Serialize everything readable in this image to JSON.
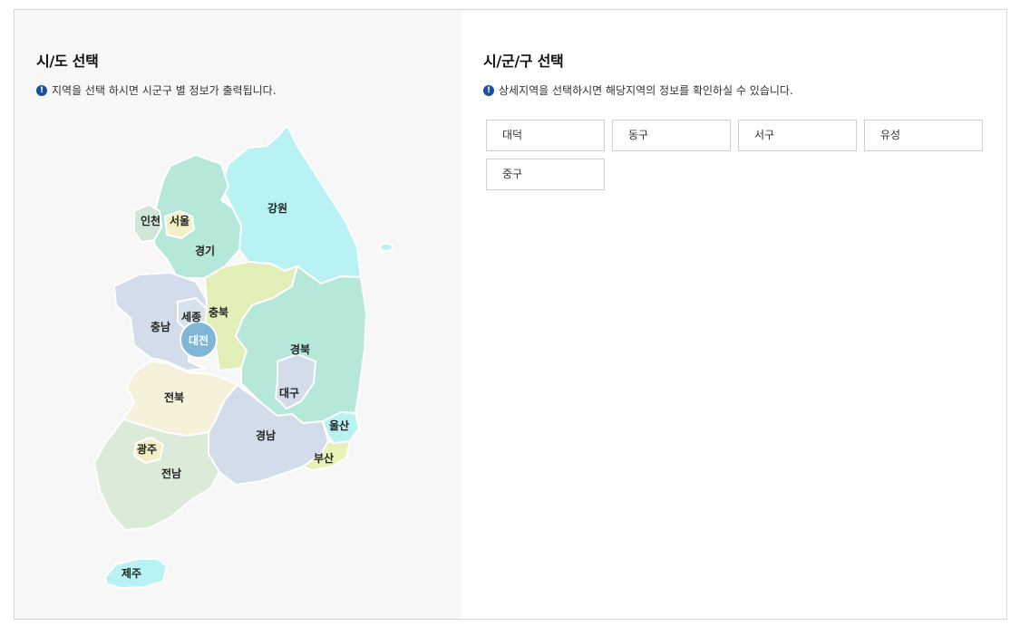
{
  "left": {
    "title": "시/도 선택",
    "info": "지역을 선택 하시면 시군구 별 정보가 출력됩니다.",
    "info_icon": "exclamation-icon",
    "selected_region": "대전",
    "regions": [
      {
        "id": "incheon",
        "label": "인천",
        "color": "#cfe6d8"
      },
      {
        "id": "seoul",
        "label": "서울",
        "color": "#f2f0c4"
      },
      {
        "id": "gyeonggi",
        "label": "경기",
        "color": "#b5e8d8"
      },
      {
        "id": "gangwon",
        "label": "강원",
        "color": "#b8f2f2"
      },
      {
        "id": "chungbuk",
        "label": "충북",
        "color": "#e2efb8"
      },
      {
        "id": "sejong",
        "label": "세종",
        "color": "#d6e3ee"
      },
      {
        "id": "chungnam",
        "label": "충남",
        "color": "#d3dcea"
      },
      {
        "id": "daejeon",
        "label": "대전",
        "color": "#7fb7d9"
      },
      {
        "id": "gyeongbuk",
        "label": "경북",
        "color": "#b5e8d8"
      },
      {
        "id": "daegu",
        "label": "대구",
        "color": "#d3dcea"
      },
      {
        "id": "jeonbuk",
        "label": "전북",
        "color": "#f5f1da"
      },
      {
        "id": "ulsan",
        "label": "울산",
        "color": "#b8f2f2"
      },
      {
        "id": "gyeongnam",
        "label": "경남",
        "color": "#d3dcea"
      },
      {
        "id": "busan",
        "label": "부산",
        "color": "#e6f2b8"
      },
      {
        "id": "gwangju",
        "label": "광주",
        "color": "#f2f0c4"
      },
      {
        "id": "jeonnam",
        "label": "전남",
        "color": "#dcebd8"
      },
      {
        "id": "jeju",
        "label": "제주",
        "color": "#b8f2f2"
      }
    ]
  },
  "right": {
    "title": "시/군/구 선택",
    "info": "상세지역을 선택하시면 해당지역의 정보를 확인하실 수 있습니다.",
    "info_icon": "exclamation-icon",
    "districts": [
      "대덕",
      "동구",
      "서구",
      "유성",
      "중구"
    ]
  }
}
